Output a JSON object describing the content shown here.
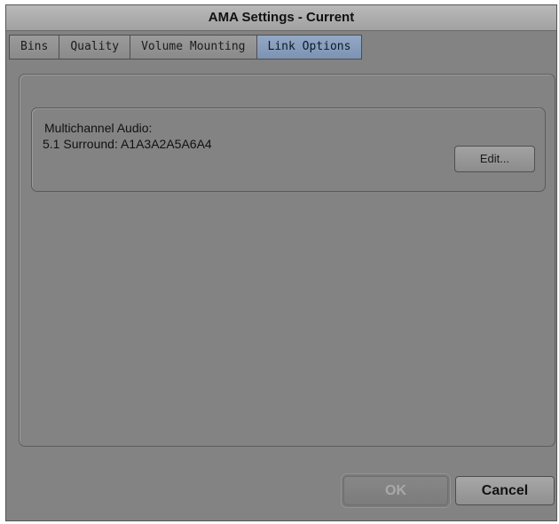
{
  "window": {
    "title": "AMA Settings - Current"
  },
  "tabs": [
    {
      "label": "Bins",
      "active": false
    },
    {
      "label": "Quality",
      "active": false
    },
    {
      "label": "Volume Mounting",
      "active": false
    },
    {
      "label": "Link Options",
      "active": true
    }
  ],
  "multichannel": {
    "label": "Multichannel Audio:",
    "value": "5.1 Surround: A1A3A2A5A6A4",
    "edit_label": "Edit..."
  },
  "footer": {
    "ok_label": "OK",
    "ok_enabled": false,
    "cancel_label": "Cancel"
  }
}
